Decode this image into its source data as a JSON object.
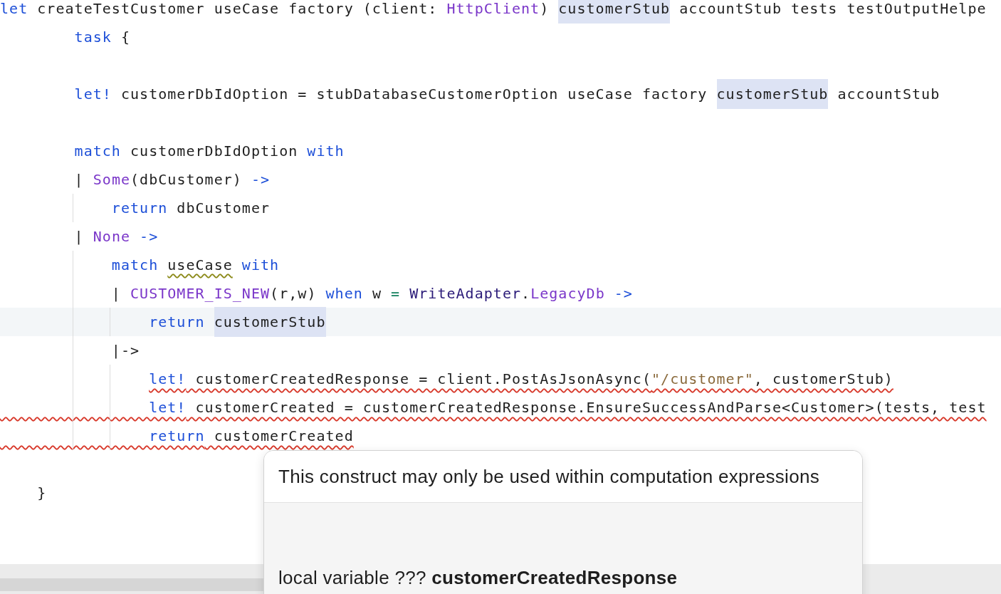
{
  "editor": {
    "lines": [
      {
        "kind": "code",
        "current": false,
        "tokens": [
          {
            "t": "let",
            "kind": "keyword"
          },
          {
            "t": " createTestCustomer useCase factory (client: ",
            "kind": "plain"
          },
          {
            "t": "HttpClient",
            "kind": "type"
          },
          {
            "t": ") ",
            "kind": "plain"
          },
          {
            "t": "customerStub",
            "kind": "occurrence"
          },
          {
            "t": " accountStub tests testOutputHelpe",
            "kind": "plain"
          }
        ]
      },
      {
        "kind": "code",
        "current": false,
        "tokens": [
          {
            "t": "        task",
            "kind": "keyword"
          },
          {
            "t": " {",
            "kind": "plain"
          }
        ]
      },
      {
        "kind": "blank",
        "current": false
      },
      {
        "kind": "code",
        "current": false,
        "tokens": [
          {
            "t": "        let!",
            "kind": "keyword"
          },
          {
            "t": " customerDbIdOption = stubDatabaseCustomerOption useCase factory ",
            "kind": "plain"
          },
          {
            "t": "customerStub",
            "kind": "occurrence"
          },
          {
            "t": " accountStub",
            "kind": "plain"
          }
        ]
      },
      {
        "kind": "blank",
        "current": false
      },
      {
        "kind": "code",
        "current": false,
        "tokens": [
          {
            "t": "        match",
            "kind": "keyword"
          },
          {
            "t": " customerDbIdOption ",
            "kind": "plain"
          },
          {
            "t": "with",
            "kind": "keyword"
          }
        ]
      },
      {
        "kind": "code",
        "current": false,
        "tokens": [
          {
            "t": "        | ",
            "kind": "plain"
          },
          {
            "t": "Some",
            "kind": "type"
          },
          {
            "t": "(dbCustomer) ",
            "kind": "plain"
          },
          {
            "t": "->",
            "kind": "keyword"
          }
        ]
      },
      {
        "kind": "code",
        "current": false,
        "tokens": [
          {
            "t": "            return",
            "kind": "keyword"
          },
          {
            "t": " dbCustomer",
            "kind": "plain"
          }
        ]
      },
      {
        "kind": "code",
        "current": false,
        "tokens": [
          {
            "t": "        | ",
            "kind": "plain"
          },
          {
            "t": "None",
            "kind": "type"
          },
          {
            "t": " ->",
            "kind": "keyword"
          }
        ]
      },
      {
        "kind": "code",
        "current": false,
        "tokens": [
          {
            "t": "            match ",
            "kind": "keyword"
          },
          {
            "t": "useCase",
            "kind": "warning"
          },
          {
            "t": " with",
            "kind": "keyword"
          }
        ]
      },
      {
        "kind": "code",
        "current": false,
        "tokens": [
          {
            "t": "            | ",
            "kind": "plain"
          },
          {
            "t": "CUSTOMER_IS_NEW",
            "kind": "type"
          },
          {
            "t": "(r,w) ",
            "kind": "plain"
          },
          {
            "t": "when",
            "kind": "keyword"
          },
          {
            "t": " w ",
            "kind": "plain"
          },
          {
            "t": "=",
            "kind": "operator"
          },
          {
            "t": " WriteAdapter",
            "kind": "module"
          },
          {
            "t": ".",
            "kind": "plain"
          },
          {
            "t": "LegacyDb",
            "kind": "type"
          },
          {
            "t": " ->",
            "kind": "keyword"
          }
        ]
      },
      {
        "kind": "code",
        "current": true,
        "tokens": [
          {
            "t": "                return ",
            "kind": "keyword"
          },
          {
            "t": "customerStub",
            "kind": "occurrence"
          }
        ]
      },
      {
        "kind": "code",
        "current": false,
        "tokens": [
          {
            "t": "            |->",
            "kind": "plain"
          }
        ]
      },
      {
        "kind": "error",
        "current": false,
        "tokens": [
          {
            "t": "                let!",
            "kind": "keyword"
          },
          {
            "t": " customerCreatedResponse = client.PostAsJsonAsync(",
            "kind": "plain"
          },
          {
            "t": "\"/customer\"",
            "kind": "string"
          },
          {
            "t": ", customerStub)",
            "kind": "plain"
          }
        ]
      },
      {
        "kind": "error_wide",
        "current": false,
        "tokens": [
          {
            "t": "                let!",
            "kind": "keyword"
          },
          {
            "t": " customerCreated = customerCreatedResponse.EnsureSuccessAndParse<Customer>(tests, test",
            "kind": "plain"
          }
        ]
      },
      {
        "kind": "error_wide",
        "current": false,
        "tokens": [
          {
            "t": "                return",
            "kind": "keyword"
          },
          {
            "t": " customerCreated",
            "kind": "plain"
          }
        ]
      },
      {
        "kind": "blank",
        "current": false
      },
      {
        "kind": "code",
        "current": false,
        "tokens": [
          {
            "t": "    }",
            "kind": "plain"
          }
        ]
      }
    ]
  },
  "popup": {
    "message": "This construct may only be used within computation expressions",
    "detail": "local variable ??? **customerCreatedResponse**"
  }
}
